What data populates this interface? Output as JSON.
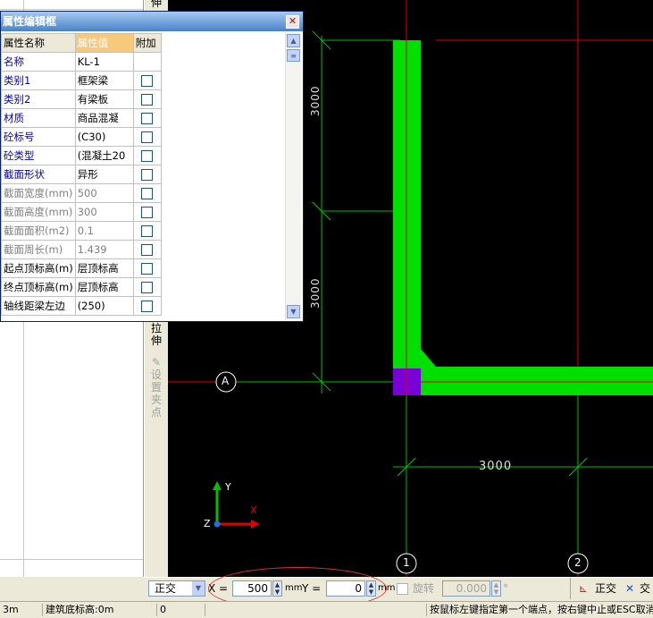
{
  "dialog": {
    "title": "属性编辑框",
    "headers": {
      "name": "属性名称",
      "value": "属性值",
      "add": "附加"
    },
    "rows": [
      {
        "name": "名称",
        "value": "KL-1",
        "style": "blue",
        "checkbox": false
      },
      {
        "name": "类别1",
        "value": "框架梁",
        "style": "blue",
        "checkbox": true
      },
      {
        "name": "类别2",
        "value": "有梁板",
        "style": "blue",
        "checkbox": true
      },
      {
        "name": "材质",
        "value": "商品混凝",
        "style": "blue",
        "checkbox": true
      },
      {
        "name": "砼标号",
        "value": "(C30)",
        "style": "blue",
        "checkbox": true
      },
      {
        "name": "砼类型",
        "value": "(混凝土20",
        "style": "blue",
        "checkbox": true
      },
      {
        "name": "截面形状",
        "value": "异形",
        "style": "blue",
        "checkbox": true
      },
      {
        "name": "截面宽度(mm)",
        "value": "500",
        "style": "gray",
        "checkbox": true
      },
      {
        "name": "截面高度(mm)",
        "value": "300",
        "style": "gray",
        "checkbox": true
      },
      {
        "name": "截面面积(m2)",
        "value": "0.1",
        "style": "gray",
        "checkbox": true
      },
      {
        "name": "截面周长(m)",
        "value": "1.439",
        "style": "gray",
        "checkbox": true
      },
      {
        "name": "起点顶标高(m)",
        "value": "层顶标高",
        "style": "normal",
        "checkbox": true
      },
      {
        "name": "终点顶标高(m)",
        "value": "层顶标高",
        "style": "normal",
        "checkbox": true
      },
      {
        "name": "轴线距梁左边",
        "value": "(250)",
        "style": "normal",
        "checkbox": true
      }
    ]
  },
  "toolbar": {
    "top_label": "伸",
    "stretch_label": "拉伸",
    "set_grip_label": "设置夹点"
  },
  "canvas": {
    "dim_vertical_1": "3000",
    "dim_vertical_2": "3000",
    "dim_horizontal": "3000",
    "axis_a": "A",
    "axis_1": "1",
    "axis_2": "2",
    "ucs_y": "Y",
    "ucs_x": "X",
    "ucs_z": "Z",
    "colors": {
      "beam": "#00e000",
      "grid": "#e00000",
      "dim": "#00c000",
      "column": "#7a00d8"
    }
  },
  "options": {
    "mode": "正交",
    "x_label": "X =",
    "x_value": "500",
    "x_unit": "mm",
    "y_label": "Y =",
    "y_value": "0",
    "y_unit": "mm",
    "rotate_label": "旋转",
    "rotate_value": "0.000",
    "rotate_unit": "°",
    "ortho_label": "正交",
    "intersect_label": "交"
  },
  "status": {
    "floor_height": "3m",
    "base_elevation": "建筑底标高:0m",
    "value": "0",
    "prompt": "按鼠标左键指定第一个端点，按右键中止或ESC取消"
  }
}
